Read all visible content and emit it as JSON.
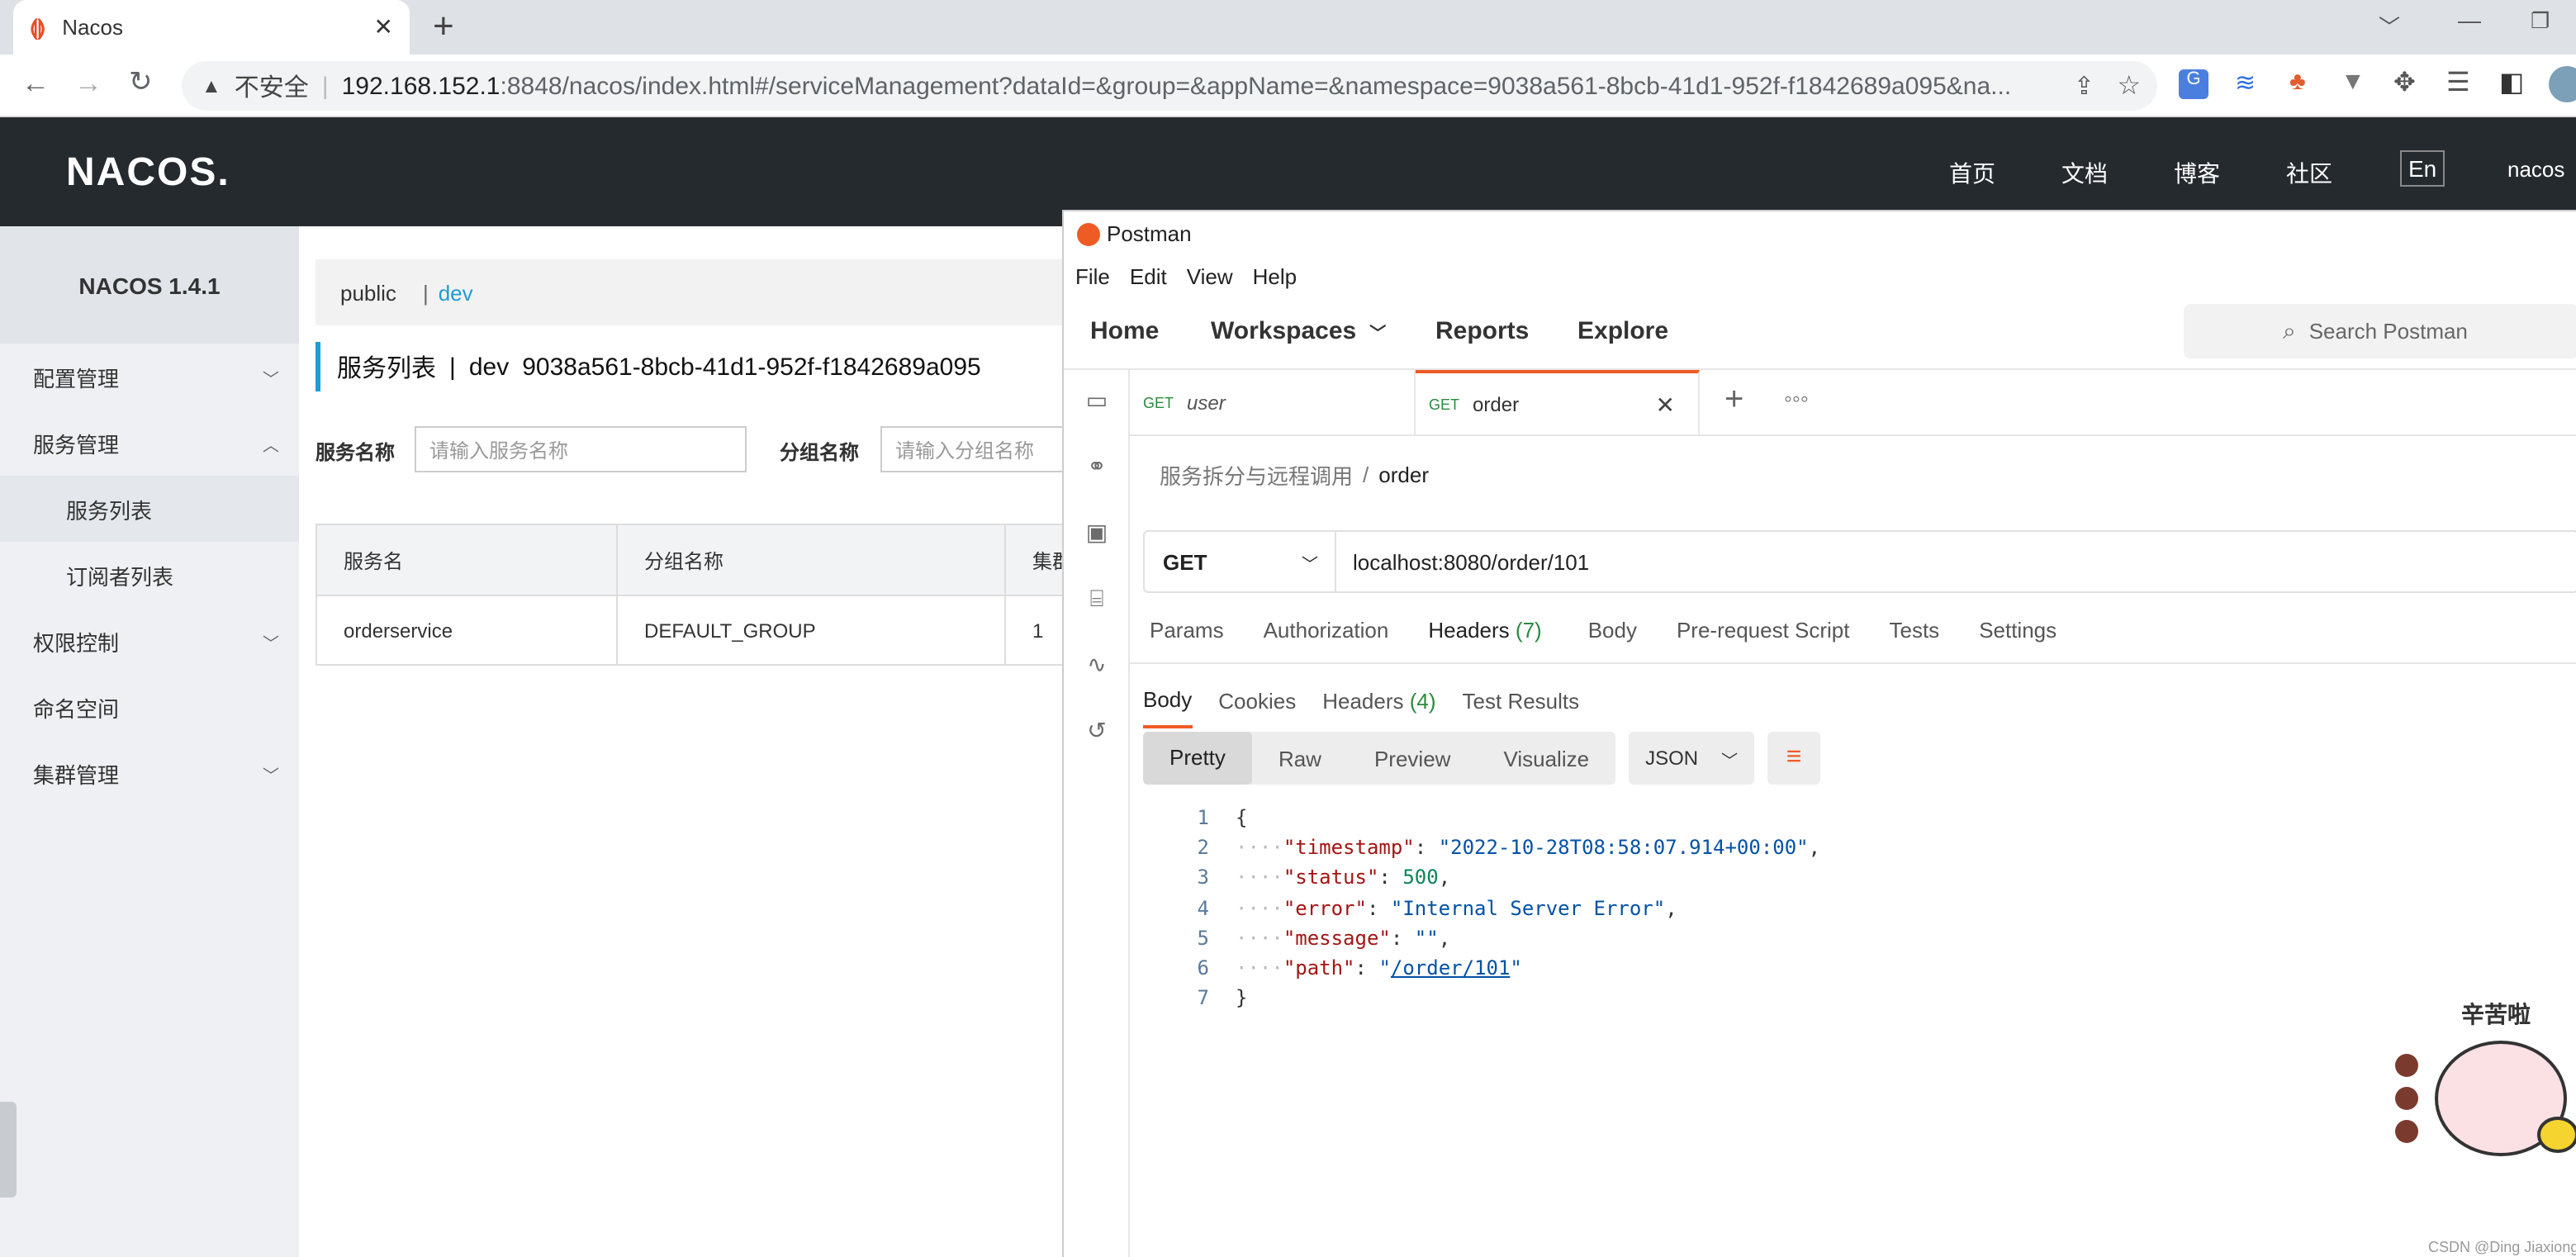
{
  "browser": {
    "tab_title": "Nacos",
    "new_tab": "+",
    "security_label": "不安全",
    "url_host": "192.168.152.1",
    "url_rest": ":8848/nacos/index.html#/serviceManagement?dataId=&group=&appName=&namespace=9038a561-8bcb-41d1-952f-f1842689a095&na..."
  },
  "nacos": {
    "logo": "NACOS.",
    "nav": [
      "首页",
      "文档",
      "博客",
      "社区"
    ],
    "lang": "En",
    "user": "nacos",
    "sidebar_title": "NACOS 1.4.1",
    "sidebar": [
      {
        "label": "配置管理",
        "chev": "﹀"
      },
      {
        "label": "服务管理",
        "chev": "︿"
      },
      {
        "label": "服务列表",
        "chev": ""
      },
      {
        "label": "订阅者列表",
        "chev": ""
      },
      {
        "label": "权限控制",
        "chev": "﹀"
      },
      {
        "label": "命名空间",
        "chev": ""
      },
      {
        "label": "集群管理",
        "chev": "﹀"
      }
    ],
    "namespaces": {
      "public": "public",
      "sep": "|",
      "dev": "dev"
    },
    "page_title": "服务列表",
    "page_title_sep": "|",
    "page_ns_name": "dev",
    "page_ns_id": "9038a561-8bcb-41d1-952f-f1842689a095",
    "service_name_label": "服务名称",
    "service_name_placeholder": "请输入服务名称",
    "group_label": "分组名称",
    "group_placeholder": "请输入分组名称",
    "table": {
      "headers": [
        "服务名",
        "分组名称",
        "集群"
      ],
      "rows": [
        [
          "orderservice",
          "DEFAULT_GROUP",
          "1"
        ]
      ]
    }
  },
  "postman": {
    "app_title": "Postman",
    "menu": [
      "File",
      "Edit",
      "View",
      "Help"
    ],
    "nav": {
      "home": "Home",
      "workspaces": "Workspaces",
      "reports": "Reports",
      "explore": "Explore"
    },
    "search_placeholder": "Search Postman",
    "tabs": [
      {
        "method": "GET",
        "name": "user"
      },
      {
        "method": "GET",
        "name": "order"
      }
    ],
    "breadcrumb_parent": "服务拆分与远程调用",
    "breadcrumb_sep": "/",
    "breadcrumb_current": "order",
    "method": "GET",
    "url": "localhost:8080/order/101",
    "request_tabs": {
      "params": "Params",
      "authorization": "Authorization",
      "headers": "Headers",
      "headers_count": "(7)",
      "body": "Body",
      "prerequest": "Pre-request Script",
      "tests": "Tests",
      "settings": "Settings"
    },
    "response_tabs": {
      "body": "Body",
      "cookies": "Cookies",
      "headers": "Headers",
      "headers_count": "(4)",
      "test_results": "Test Results"
    },
    "formats": [
      "Pretty",
      "Raw",
      "Preview",
      "Visualize"
    ],
    "lang": "JSON",
    "response_lines": [
      "1",
      "2",
      "3",
      "4",
      "5",
      "6",
      "7"
    ],
    "response": {
      "timestamp_key": "\"timestamp\"",
      "timestamp_val": "\"2022-10-28T08:58:07.914+00:00\"",
      "status_key": "\"status\"",
      "status_val": "500",
      "error_key": "\"error\"",
      "error_val": "\"Internal Server Error\"",
      "message_key": "\"message\"",
      "message_val": "\"\"",
      "path_key": "\"path\"",
      "path_val": "/order/101"
    }
  },
  "sticker_text": "辛苦啦",
  "watermark": "CSDN @Ding Jiaxiong"
}
